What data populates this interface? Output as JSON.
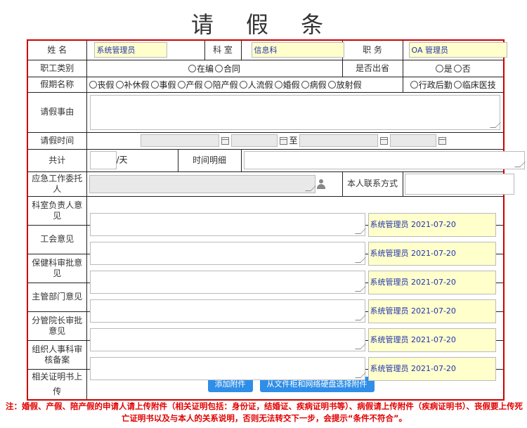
{
  "title": "请 假 条",
  "row1": {
    "name_label": "姓 名",
    "name_value": "系统管理员",
    "dept_label": "科 室",
    "dept_value": "信息科",
    "position_label": "职 务",
    "position_value": "OA 管理员"
  },
  "row2": {
    "category_label": "职工类别",
    "category_options": [
      "在编",
      "合同"
    ],
    "out_of_province_label": "是否出省",
    "out_of_province_options": [
      "是",
      "否"
    ]
  },
  "row3": {
    "leave_type_label": "假期名称",
    "leave_types": [
      "丧假",
      "补休假",
      "事假",
      "产假",
      "陪产假",
      "人流假",
      "婚假",
      "病假",
      "放射假"
    ],
    "staff_types": [
      "行政后勤",
      "临床医技"
    ]
  },
  "row4": {
    "reason_label": "请假事由"
  },
  "row5": {
    "time_label": "请假时间",
    "to_label": "至"
  },
  "row6": {
    "total_label": "共计",
    "unit_label": "/天",
    "detail_label": "时间明细"
  },
  "row7": {
    "delegate_label": "应急工作委托人",
    "contact_label": "本人联系方式"
  },
  "opinions": [
    {
      "label": "科室负责人意见",
      "signer": "系统管理员 2021-07-20"
    },
    {
      "label": "工会意见",
      "signer": "系统管理员 2021-07-20"
    },
    {
      "label": "保健科审批意见",
      "signer": "系统管理员 2021-07-20"
    },
    {
      "label": "主管部门意见",
      "signer": "系统管理员 2021-07-20"
    },
    {
      "label": "分管院长审批意见",
      "signer": "系统管理员 2021-07-20"
    },
    {
      "label": "组织人事科审核备案",
      "signer": "系统管理员 2021-07-20"
    }
  ],
  "attachments": {
    "label": "相关证明书上传",
    "add_button": "添加附件",
    "select_button": "从文件柜和网络硬盘选择附件"
  },
  "note": "注：婚假、产假、陪产假的申请人请上传附件（相关证明包括：身份证，结婚证、疾病证明书等）、病假请上传附件（疾病证明书）、丧假要上传死亡证明书以及与本人的关系说明，否则无法转交下一步，会提示“条件不符合”。"
}
